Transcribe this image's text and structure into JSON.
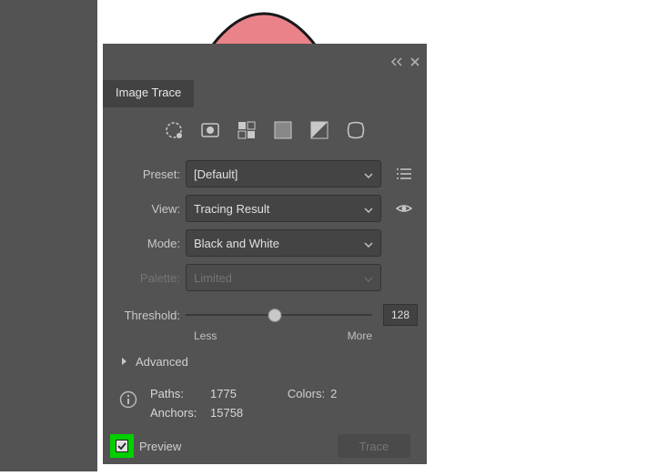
{
  "panel": {
    "title": "Image Trace",
    "presetLabel": "Preset:",
    "presetValue": "[Default]",
    "viewLabel": "View:",
    "viewValue": "Tracing Result",
    "modeLabel": "Mode:",
    "modeValue": "Black and White",
    "paletteLabel": "Palette:",
    "paletteValue": "Limited",
    "thresholdLabel": "Threshold:",
    "thresholdValue": "128",
    "thresholdMin": "Less",
    "thresholdMax": "More",
    "advancedLabel": "Advanced",
    "info": {
      "pathsLabel": "Paths:",
      "pathsValue": "1775",
      "anchorsLabel": "Anchors:",
      "anchorsValue": "15758",
      "colorsLabel": "Colors:",
      "colorsValue": "2"
    },
    "previewLabel": "Preview",
    "traceButton": "Trace"
  }
}
